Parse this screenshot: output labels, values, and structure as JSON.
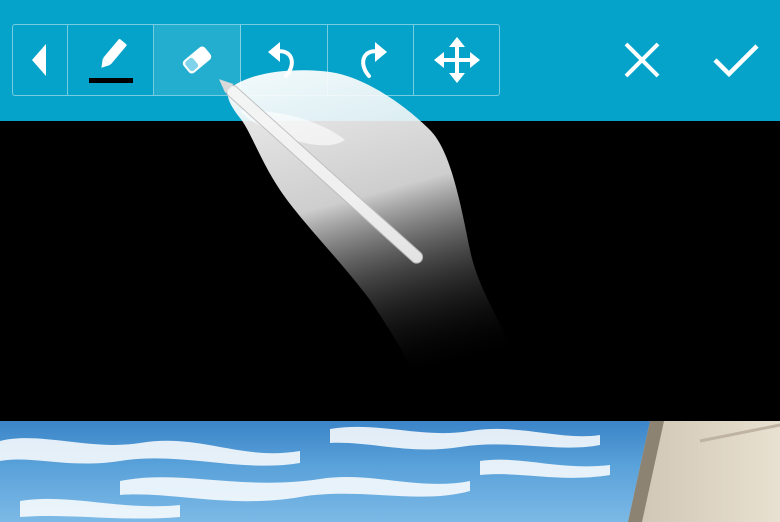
{
  "toolbar": {
    "background": "#05a3c9",
    "tools": [
      {
        "id": "back",
        "icon": "back-arrow-icon"
      },
      {
        "id": "pen",
        "icon": "pen-icon",
        "pen_color": "#000000"
      },
      {
        "id": "eraser",
        "icon": "eraser-icon"
      },
      {
        "id": "undo",
        "icon": "undo-icon"
      },
      {
        "id": "redo",
        "icon": "redo-icon"
      },
      {
        "id": "move",
        "icon": "move-icon"
      }
    ],
    "actions": [
      {
        "id": "cancel",
        "icon": "close-icon"
      },
      {
        "id": "confirm",
        "icon": "check-icon"
      }
    ]
  },
  "canvas": {
    "background": "#000000"
  },
  "photo": {
    "description_icon": "sky-photo",
    "sky_color": "#3b84c8"
  }
}
